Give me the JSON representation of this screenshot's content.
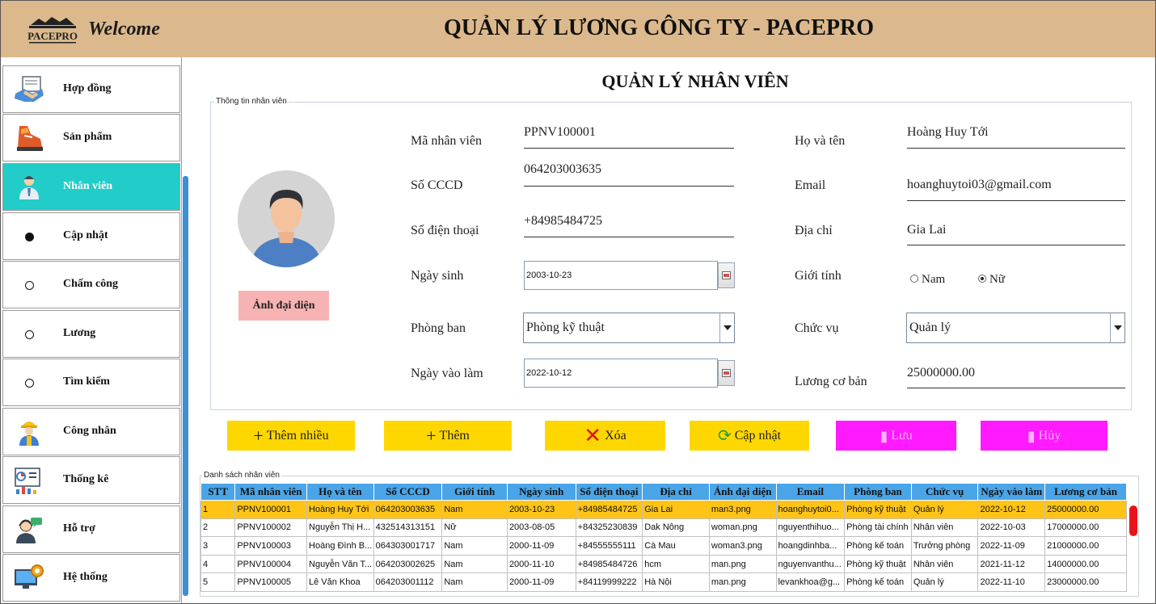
{
  "header": {
    "logo_text": "PACEPRO",
    "welcome": "Welcome",
    "title": "QUẢN LÝ LƯƠNG CÔNG TY - PACEPRO"
  },
  "sidebar": {
    "items": [
      {
        "label": "Hợp đồng",
        "icon": "contract-handshake-icon"
      },
      {
        "label": "Sản phẩm",
        "icon": "shoe-product-icon"
      },
      {
        "label": "Nhân viên",
        "icon": "employee-icon",
        "active": true
      },
      {
        "label": "Cập nhật",
        "icon": "bullet-filled"
      },
      {
        "label": "Chấm công",
        "icon": "bullet-empty"
      },
      {
        "label": "Lương",
        "icon": "bullet-empty"
      },
      {
        "label": "Tìm kiếm",
        "icon": "bullet-empty"
      },
      {
        "label": "Công nhân",
        "icon": "worker-icon"
      },
      {
        "label": "Thống kê",
        "icon": "statistics-icon"
      },
      {
        "label": "Hỗ trợ",
        "icon": "support-icon"
      },
      {
        "label": "Hệ thống",
        "icon": "system-settings-icon"
      }
    ],
    "active_color": "#22cdc9"
  },
  "main": {
    "title": "QUẢN LÝ NHÂN VIÊN",
    "info_legend": "Thông tin nhân viên",
    "avatar_button": "Ảnh đại diện",
    "fields": {
      "ma_nv": {
        "label": "Mã nhân viên",
        "value": "PPNV100001"
      },
      "ho_ten": {
        "label": "Họ và tên",
        "value": "Hoàng Huy Tới"
      },
      "cccd": {
        "label": "Số CCCD",
        "value": "064203003635"
      },
      "email": {
        "label": "Email",
        "value": "hoanghuytoi03@gmail.com"
      },
      "sdt": {
        "label": "Số điện thoại",
        "value": "+84985484725"
      },
      "dia_chi": {
        "label": "Địa chỉ",
        "value": "Gia Lai"
      },
      "ngay_sinh": {
        "label": "Ngày sinh",
        "value": "2003-10-23"
      },
      "gioi_tinh": {
        "label": "Giới tính",
        "options": [
          "Nam",
          "Nữ"
        ],
        "selected": "Nữ"
      },
      "phong_ban": {
        "label": "Phòng ban",
        "value": "Phòng kỹ thuật"
      },
      "chuc_vu": {
        "label": "Chức vụ",
        "value": "Quản lý"
      },
      "ngay_vao_lam": {
        "label": "Ngày vào làm",
        "value": "2022-10-12"
      },
      "luong_co_ban": {
        "label": "Lương cơ bản",
        "value": "25000000.00"
      }
    },
    "actions": {
      "them_nhieu": "Thêm nhiều",
      "them": "Thêm",
      "xoa": "Xóa",
      "cap_nhat": "Cập nhật",
      "luu": "Lưu",
      "huy": "Hủy"
    },
    "table": {
      "legend": "Danh sách nhân viên",
      "columns": [
        "STT",
        "Mã nhân viên",
        "Họ và tên",
        "Số CCCD",
        "Giới tính",
        "Ngày sinh",
        "Số điện thoại",
        "Địa chỉ",
        "Ảnh đại diện",
        "Email",
        "Phòng ban",
        "Chức vụ",
        "Ngày vào làm",
        "Lương cơ bản"
      ],
      "rows": [
        [
          "1",
          "PPNV100001",
          "Hoàng Huy Tới",
          "064203003635",
          "Nam",
          "2003-10-23",
          "+84985484725",
          "Gia Lai",
          "man3.png",
          "hoanghuytoi0...",
          "Phòng kỹ thuật",
          "Quản lý",
          "2022-10-12",
          "25000000.00"
        ],
        [
          "2",
          "PPNV100002",
          "Nguyễn Thị H...",
          "432514313151",
          "Nữ",
          "2003-08-05",
          "+84325230839",
          "Dak Nông",
          "woman.png",
          "nguyenthihuo...",
          "Phòng tài chính",
          "Nhân viên",
          "2022-10-03",
          "17000000.00"
        ],
        [
          "3",
          "PPNV100003",
          "Hoàng Đình B...",
          "064303001717",
          "Nam",
          "2000-11-09",
          "+84555555111",
          "Cà Mau",
          "woman3.png",
          "hoangdinhba...",
          "Phòng kế toán",
          "Trưởng phòng",
          "2022-11-09",
          "21000000.00"
        ],
        [
          "4",
          "PPNV100004",
          "Nguyễn Văn T...",
          "064203002625",
          "Nam",
          "2000-11-10",
          "+84985484726",
          "hcm",
          "man.png",
          "nguyenvanthu...",
          "Phòng kỹ thuật",
          "Nhân viên",
          "2021-11-12",
          "14000000.00"
        ],
        [
          "5",
          "PPNV100005",
          "Lê Văn Khoa",
          "064203001112",
          "Nam",
          "2000-11-09",
          "+84119999222",
          "Hà Nội",
          "man.png",
          "levankhoa@g...",
          "Phòng kế toán",
          "Quản lý",
          "2022-11-10",
          "23000000.00"
        ]
      ],
      "selected_row": 0
    }
  }
}
